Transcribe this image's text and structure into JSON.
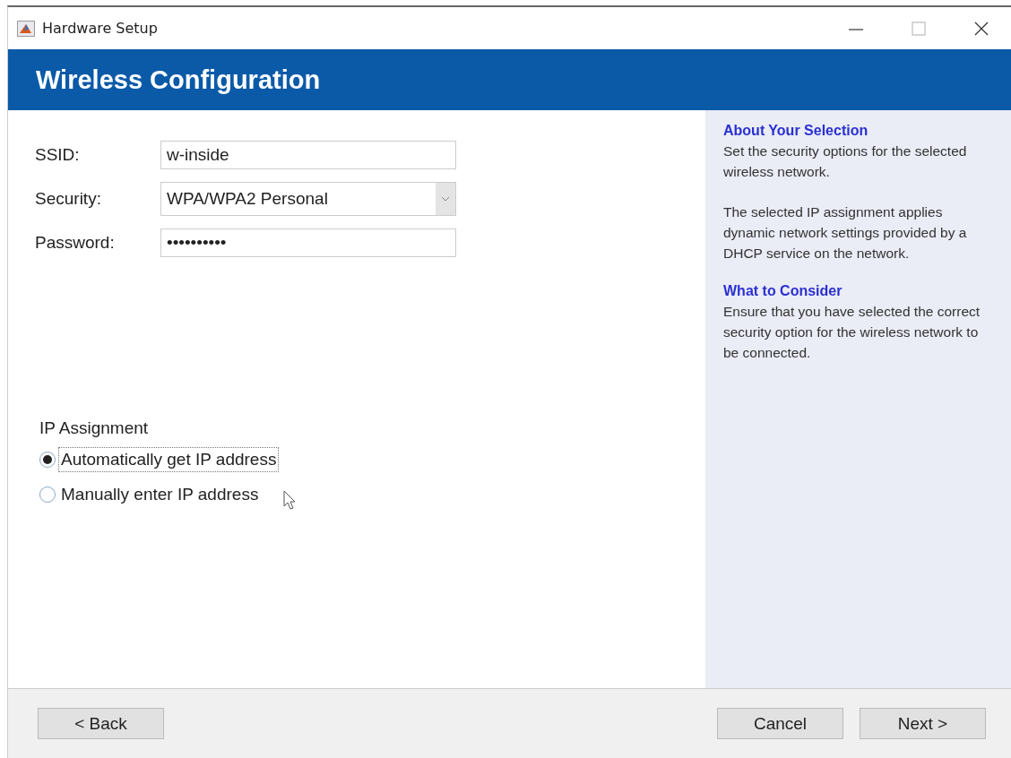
{
  "window": {
    "title": "Hardware Setup"
  },
  "header": {
    "title": "Wireless Configuration"
  },
  "form": {
    "fields": [
      {
        "kind": "text",
        "label": "SSID:",
        "value": "w-inside"
      },
      {
        "kind": "dropdown",
        "label": "Security:",
        "value": "WPA/WPA2 Personal"
      },
      {
        "kind": "text",
        "label": "Password:",
        "value": "••••••••••"
      }
    ]
  },
  "ip_assignment": {
    "title": "IP Assignment",
    "options": [
      {
        "label": "Automatically get IP address",
        "selected": true,
        "focused": true
      },
      {
        "label": "Manually enter IP address",
        "selected": false,
        "focused": false
      }
    ]
  },
  "help": {
    "sections": [
      {
        "heading": "About Your Selection",
        "paragraphs": [
          "Set the security options for the selected wireless network.",
          "The selected IP assignment applies dynamic network settings provided by a DHCP service on the network."
        ]
      },
      {
        "heading": "What to Consider",
        "paragraphs": [
          "Ensure that you have selected the correct security option for the wireless network to be connected."
        ]
      }
    ]
  },
  "footer": {
    "left_buttons": [
      "< Back"
    ],
    "right_buttons": [
      "Cancel",
      "Next >"
    ]
  }
}
